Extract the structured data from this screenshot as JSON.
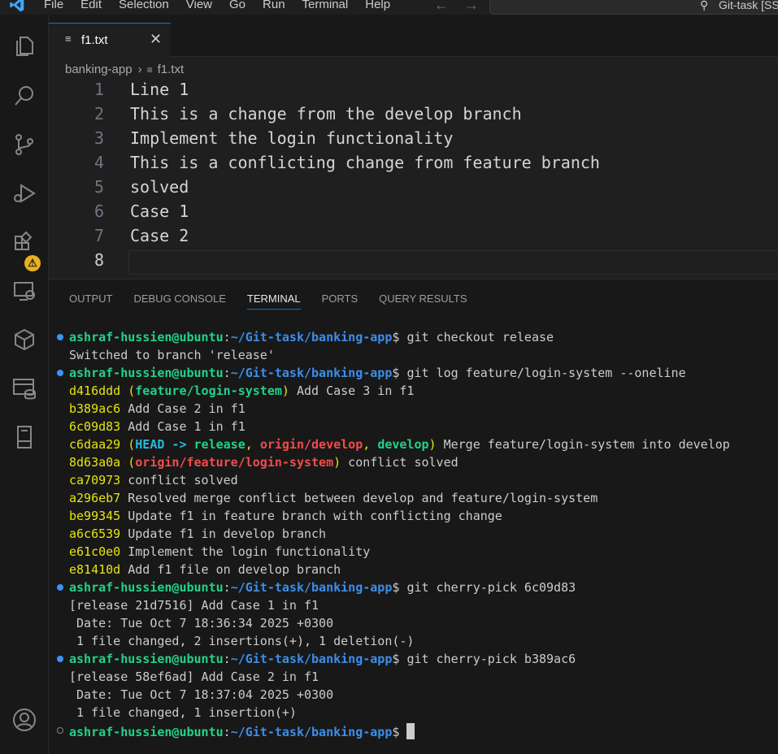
{
  "titlebar": {
    "menu": [
      "File",
      "Edit",
      "Selection",
      "View",
      "Go",
      "Run",
      "Terminal",
      "Help"
    ],
    "search_text": "Git-task [SS"
  },
  "activity_bar": {
    "items": [
      "explorer-icon",
      "search-icon",
      "source-control-icon",
      "run-debug-icon",
      "extensions-icon",
      "remote-explorer-icon",
      "package-icon",
      "database-icon",
      "device-icon",
      "account-icon"
    ],
    "extensions_badge": "⚠"
  },
  "tab": {
    "label": "f1.txt",
    "close": "✕"
  },
  "breadcrumb": {
    "folder": "banking-app",
    "file": "f1.txt"
  },
  "editor": {
    "lines": [
      {
        "n": "1",
        "text": "Line 1"
      },
      {
        "n": "2",
        "text": "This is a change from the develop branch"
      },
      {
        "n": "3",
        "text": "Implement the login functionality"
      },
      {
        "n": "4",
        "text": "This is a conflicting change from feature branch"
      },
      {
        "n": "5",
        "text": "solved"
      },
      {
        "n": "6",
        "text": "Case 1"
      },
      {
        "n": "7",
        "text": "Case 2"
      },
      {
        "n": "8",
        "text": ""
      }
    ]
  },
  "panel": {
    "tabs": [
      "OUTPUT",
      "DEBUG CONSOLE",
      "TERMINAL",
      "PORTS",
      "QUERY RESULTS"
    ],
    "active_tab": "TERMINAL"
  },
  "terminal": {
    "user": "ashraf-hussien@ubuntu",
    "path": "~/Git-task/banking-app",
    "prompt_suffix": "$ ",
    "cmd1": "git checkout release",
    "out1": "Switched to branch 'release'",
    "cmd2": "git log feature/login-system --oneline",
    "log": [
      {
        "hash": "d416ddd",
        "ref_open": " (",
        "ref1": "feature/login-system",
        "ref_close": ")",
        "msg": " Add Case 3 in f1"
      },
      {
        "hash": "b389ac6",
        "msg": " Add Case 2 in f1"
      },
      {
        "hash": "6c09d83",
        "msg": " Add Case 1 in f1"
      },
      {
        "hash": "c6daa29",
        "head": "HEAD",
        "arrow": " -> ",
        "release": "release",
        "origin_develop": "origin/develop",
        "develop": "develop",
        "msg": " Merge feature/login-system into develop"
      },
      {
        "hash": "8d63a0a",
        "origin_feature": "origin/feature/login-system",
        "msg": " conflict solved"
      },
      {
        "hash": "ca70973",
        "msg": " conflict solved"
      },
      {
        "hash": "a296eb7",
        "msg": " Resolved merge conflict between develop and feature/login-system"
      },
      {
        "hash": "be99345",
        "msg": " Update f1 in feature branch with conflicting change"
      },
      {
        "hash": "a6c6539",
        "msg": " Update f1 in develop branch"
      },
      {
        "hash": "e61c0e0",
        "msg": " Implement the login functionality"
      },
      {
        "hash": "e81410d",
        "msg": " Add f1 file on develop branch"
      }
    ],
    "cmd3": "git cherry-pick 6c09d83",
    "out3": [
      "[release 21d7516] Add Case 1 in f1",
      " Date: Tue Oct 7 18:36:34 2025 +0300",
      " 1 file changed, 2 insertions(+), 1 deletion(-)"
    ],
    "cmd4": "git cherry-pick b389ac6",
    "out4": [
      "[release 58ef6ad] Add Case 2 in f1",
      " Date: Tue Oct 7 18:37:04 2025 +0300",
      " 1 file changed, 1 insertion(+)"
    ]
  }
}
